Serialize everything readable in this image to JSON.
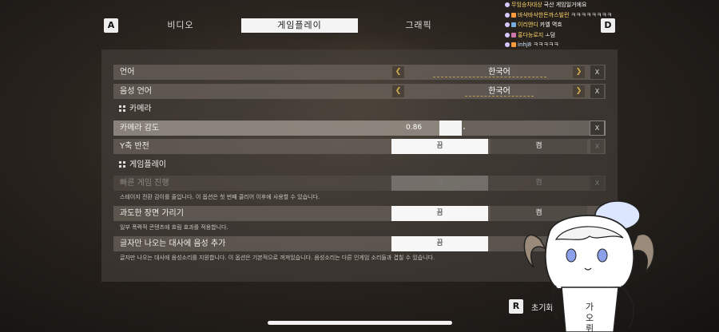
{
  "tabbar": {
    "left_key": "A",
    "right_key": "D",
    "tabs": [
      {
        "label": "비디오",
        "active": false
      },
      {
        "label": "게임플레이",
        "active": true
      },
      {
        "label": "그래픽",
        "active": false
      }
    ]
  },
  "chat": [
    {
      "name": "무임승차대상",
      "message": "국산 게임일거에요"
    },
    {
      "name": "바삭바삭한돈까스빌런",
      "message": "ㅋㅋㅋㅋㅋㅋㅋㅋ"
    },
    {
      "name": "이리앤디",
      "message": "카엘 멱흐"
    },
    {
      "name": "홍다능로지",
      "message": "ㅗ덤"
    },
    {
      "name": "inhj8",
      "message": "ㅋㅋㅋㅋㅋ"
    }
  ],
  "settings": {
    "language": {
      "label": "언어",
      "value": "한국어",
      "reset": "X"
    },
    "voice_language": {
      "label": "음성 언어",
      "value": "한국어",
      "reset": "X"
    },
    "camera_section": "카메라",
    "camera_sensitivity": {
      "label": "카메라 감도",
      "value": "0.86",
      "fill_fraction": 0.15,
      "reset": "X"
    },
    "invert_y": {
      "label": "Y축 반전",
      "off": "끔",
      "on": "켬",
      "reset": "X"
    },
    "gameplay_section": "게임플레이",
    "fast_play": {
      "label": "빠른 게임 진행",
      "off": "끔",
      "on": "켬",
      "reset": "X",
      "description": "스테이지 전환 감이를 줄입니다. 이 옵션은 첫 번째 클리어 이후에 사용할 수 있습니다."
    },
    "hide_violence": {
      "label": "과도한 장면 가리기",
      "off": "끔",
      "on": "켬",
      "description": "일부 폭력적 콘텐츠에 흐림 효과를 적용합니다."
    },
    "voice_for_text": {
      "label": "글자만 나오는 대사에 음성 추가",
      "off": "끔",
      "description": "글자만 나오는 대사에 음성소리를 지원합니다. 이 옵션은 기본적으로 꺼져있습니다. 음성소리는 다른 인게임 소리들과 겹칠 수 있습니다."
    }
  },
  "footer": {
    "key": "R",
    "label": "초기화"
  },
  "colors": {
    "accent_arrow": "#d8b04a",
    "chat_name": "#ffd86b"
  }
}
